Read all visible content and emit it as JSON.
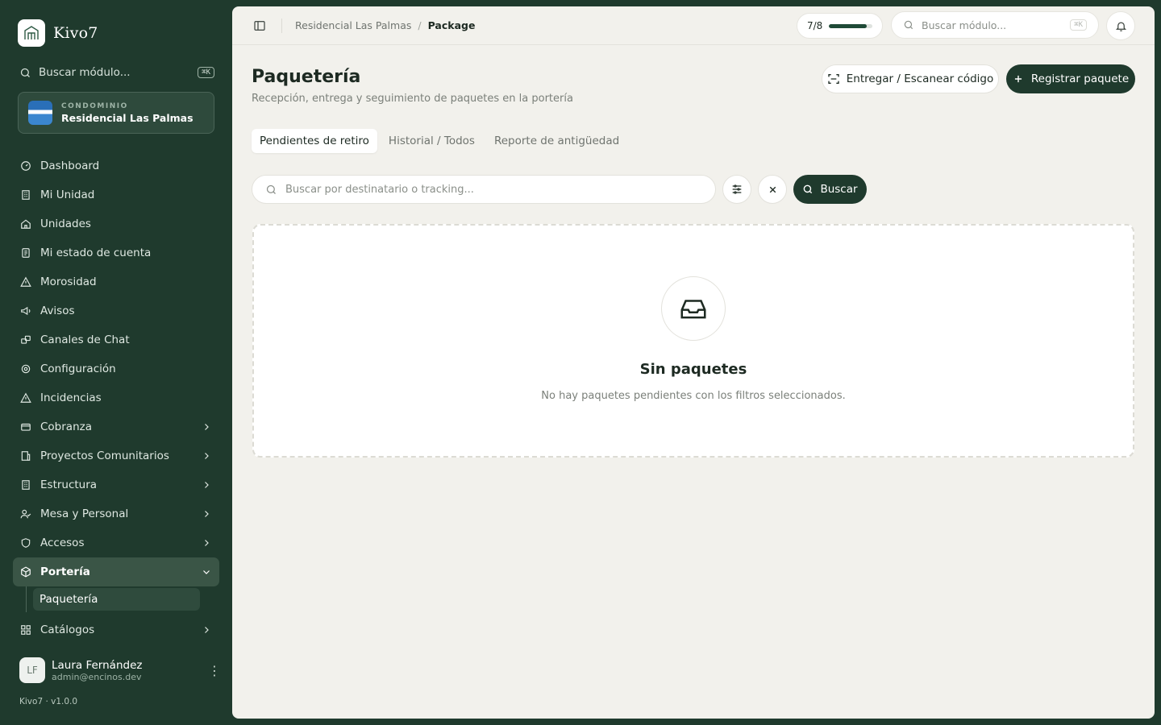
{
  "brand": {
    "name": "Kivo7"
  },
  "sidebar": {
    "search_label": "Buscar módulo...",
    "shortcut": "⌘K",
    "condo": {
      "label": "CONDOMINIO",
      "name": "Residencial Las Palmas"
    },
    "items": [
      {
        "label": "Dashboard",
        "icon": "dashboard-icon"
      },
      {
        "label": "Mi Unidad",
        "icon": "building-icon"
      },
      {
        "label": "Unidades",
        "icon": "home-icon"
      },
      {
        "label": "Mi estado de cuenta",
        "icon": "receipt-icon"
      },
      {
        "label": "Morosidad",
        "icon": "warning-icon"
      },
      {
        "label": "Avisos",
        "icon": "megaphone-icon"
      },
      {
        "label": "Canales de Chat",
        "icon": "chat-icon"
      },
      {
        "label": "Configuración",
        "icon": "gear-icon"
      },
      {
        "label": "Incidencias",
        "icon": "warning-icon"
      },
      {
        "label": "Cobranza",
        "icon": "wallet-icon"
      },
      {
        "label": "Proyectos Comunitarios",
        "icon": "project-icon"
      },
      {
        "label": "Estructura",
        "icon": "building-icon"
      },
      {
        "label": "Mesa y Personal",
        "icon": "users-icon"
      },
      {
        "label": "Accesos",
        "icon": "shield-icon"
      },
      {
        "label": "Portería",
        "icon": "box-icon"
      },
      {
        "label": "Paquetería"
      },
      {
        "label": "Catálogos",
        "icon": "grid-icon"
      }
    ],
    "user": {
      "initials": "LF",
      "name": "Laura Fernández",
      "email": "admin@encinos.dev"
    },
    "version": "Kivo7 · v1.0.0"
  },
  "topbar": {
    "breadcrumb": [
      "Residencial Las Palmas",
      "Package"
    ],
    "breadcrumb_sep": "/",
    "progress": {
      "label": "7/8",
      "value": 0.875
    },
    "search_placeholder": "Buscar módulo...",
    "shortcut": "⌘K"
  },
  "page": {
    "title": "Paquetería",
    "subtitle": "Recepción, entrega y seguimiento de paquetes en la portería",
    "scan_button": "Entregar / Escanear código",
    "register_button": "Registrar paquete",
    "tabs": [
      "Pendientes de retiro",
      "Historial / Todos",
      "Reporte de antigüedad"
    ],
    "search_placeholder": "Buscar por destinatario o tracking...",
    "search_button": "Buscar",
    "empty": {
      "title": "Sin paquetes",
      "text": "No hay paquetes pendientes con los filtros seleccionados."
    }
  },
  "colors": {
    "sidebar_bg": "#1f3a2d",
    "accent": "#1f3a2d",
    "main_bg": "#f2f1ec"
  }
}
